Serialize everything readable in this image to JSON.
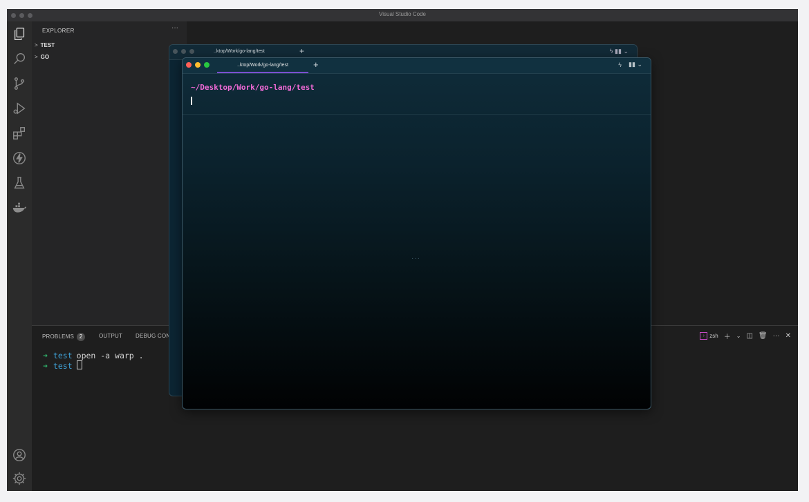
{
  "window_title": "Visual Studio Code",
  "activity_icons": [
    "explorer-icon",
    "search-icon",
    "source-control-icon",
    "run-debug-icon",
    "extensions-icon",
    "lightning-icon",
    "testing-flask-icon",
    "docker-whale-icon",
    "account-icon",
    "manage-gear-icon"
  ],
  "sidebar": {
    "header": "EXPLORER",
    "more": "···",
    "folders": [
      {
        "chevron": ">",
        "label": "TEST"
      },
      {
        "chevron": ">",
        "label": "GO"
      }
    ]
  },
  "panel": {
    "tabs": [
      {
        "label": "PROBLEMS",
        "badge": "2"
      },
      {
        "label": "OUTPUT"
      },
      {
        "label": "DEBUG CON"
      }
    ],
    "shell_label": "zsh",
    "terminal_lines": [
      {
        "prompt": "➜",
        "dir": "test",
        "cmd": "open -a warp ."
      },
      {
        "prompt": "➜",
        "dir": "test",
        "cmd": ""
      }
    ]
  },
  "warp_back": {
    "tab_title": "..ktop/Work/go-lang/test",
    "new_tab": "+"
  },
  "warp": {
    "tab_title": "..ktop/Work/go-lang/test",
    "new_tab": "+",
    "cwd": "~/Desktop/Work/go-lang/test",
    "dots": "···",
    "accent_color": "#7b4fd1",
    "path_color": "#f16ad7"
  }
}
